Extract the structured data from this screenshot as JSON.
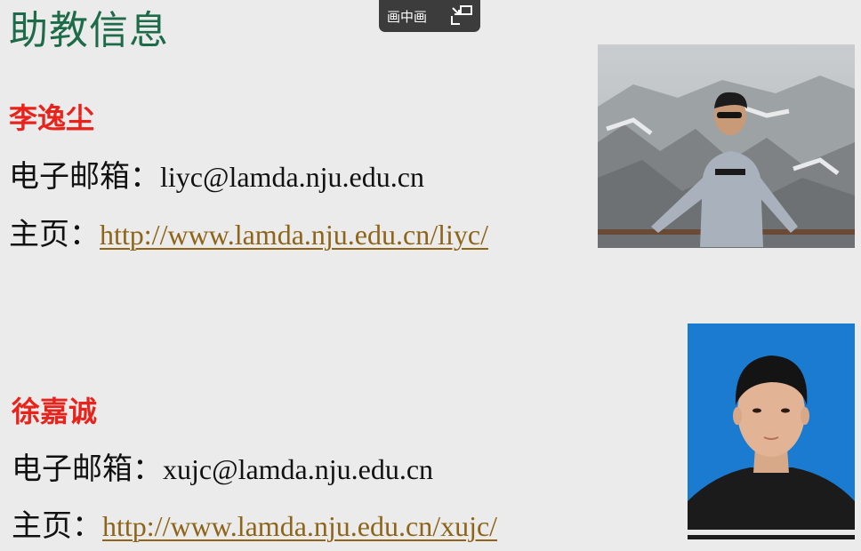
{
  "title": "助教信息",
  "pip_button": {
    "label": "画中画",
    "icon": "exit-pip-icon"
  },
  "people": [
    {
      "name": "李逸尘",
      "email_label": "电子邮箱：",
      "email": "liyc@lamda.nju.edu.cn",
      "homepage_label": "主页：",
      "homepage": "http://www.lamda.nju.edu.cn/liyc/",
      "photo": "portrait-mountain-photo"
    },
    {
      "name": "徐嘉诚",
      "email_label": "电子邮箱：",
      "email": "xujc@lamda.nju.edu.cn",
      "homepage_label": "主页：",
      "homepage": "http://www.lamda.nju.edu.cn/xujc/",
      "photo": "portrait-blue-background-photo"
    }
  ],
  "colors": {
    "background": "#ebebeb",
    "title": "#1e6b4a",
    "name": "#e8231c",
    "link": "#8e6419",
    "text": "#111111"
  }
}
